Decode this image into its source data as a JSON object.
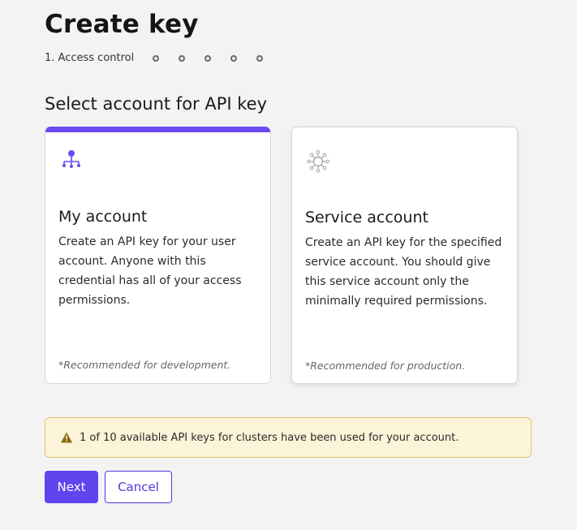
{
  "header": {
    "title": "Create key",
    "stepper": {
      "current_label": "1. Access control",
      "remaining_steps": 5
    }
  },
  "section": {
    "title": "Select account for API key"
  },
  "cards": [
    {
      "title": "My account",
      "description": "Create an API key for your user account. Anyone with this credential has all of your access permissions.",
      "note": "*Recommended for development.",
      "icon": "hierarchy-icon",
      "selected": true
    },
    {
      "title": "Service account",
      "description": "Create an API key for the specified service account. You should give this service account only the minimally required permissions.",
      "note": "*Recommended for production.",
      "icon": "service-network-icon",
      "selected": false
    }
  ],
  "banner": {
    "icon": "warning-icon",
    "text": "1 of 10 available API keys for clusters have been used for your account."
  },
  "buttons": {
    "next_label": "Next",
    "cancel_label": "Cancel"
  },
  "colors": {
    "accent": "#6044ee",
    "warning_bg": "#fbf4d8",
    "warning_border": "#e3c46a"
  }
}
